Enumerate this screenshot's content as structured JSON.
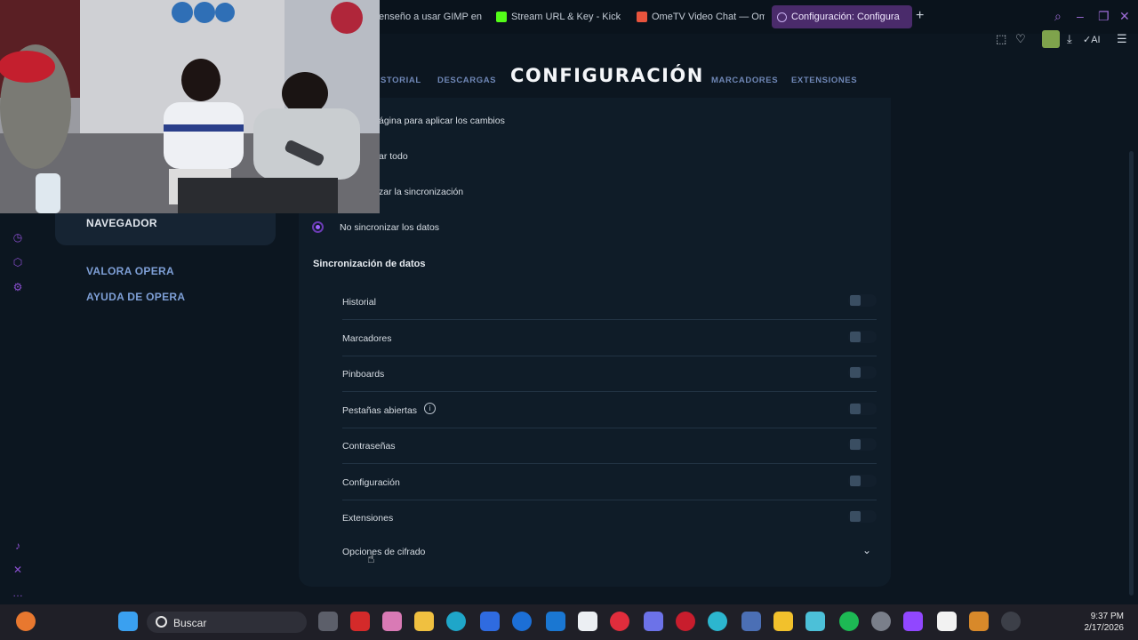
{
  "tabs": [
    {
      "label": "enseño a usar GIMP en",
      "color": "#2b2b2b"
    },
    {
      "label": "Stream URL & Key - Kick",
      "color": "#53fc18"
    },
    {
      "label": "OmeTV Video Chat — Om",
      "color": "#e8543d"
    },
    {
      "label": "Configuración: Configura",
      "color": "#8e5bd8",
      "active": true
    }
  ],
  "header": {
    "title": "CONFIGURACIÓN",
    "nav": {
      "historial": "STORIAL",
      "descargas": "DESCARGAS",
      "marcadores": "MARCADORES",
      "extensiones": "EXTENSIONES"
    }
  },
  "sidebar": {
    "active": "NAVEGADOR",
    "links": [
      "VALORA OPERA",
      "AYUDA DE OPERA"
    ]
  },
  "sync": {
    "partial_lines": [
      "ágina para aplicar los cambios",
      "ar todo",
      "zar la sincronización"
    ],
    "radio_label": "No sincronizar los datos",
    "heading": "Sincronización de datos",
    "items": [
      {
        "label": "Historial",
        "on": false
      },
      {
        "label": "Marcadores",
        "on": false
      },
      {
        "label": "Pinboards",
        "on": false
      },
      {
        "label": "Pestañas abiertas",
        "on": false,
        "info": true
      },
      {
        "label": "Contraseñas",
        "on": false
      },
      {
        "label": "Configuración",
        "on": false
      },
      {
        "label": "Extensiones",
        "on": false
      }
    ],
    "encryption_label": "Opciones de cifrado"
  },
  "toolbar": {
    "ai_label": "AI"
  },
  "taskbar": {
    "search_label": "Buscar",
    "time": "9:37 PM",
    "date": "2/17/2026"
  },
  "colors": {
    "accent": "#8e5bd8",
    "background": "#0c1620",
    "panel": "#0f1c28"
  }
}
